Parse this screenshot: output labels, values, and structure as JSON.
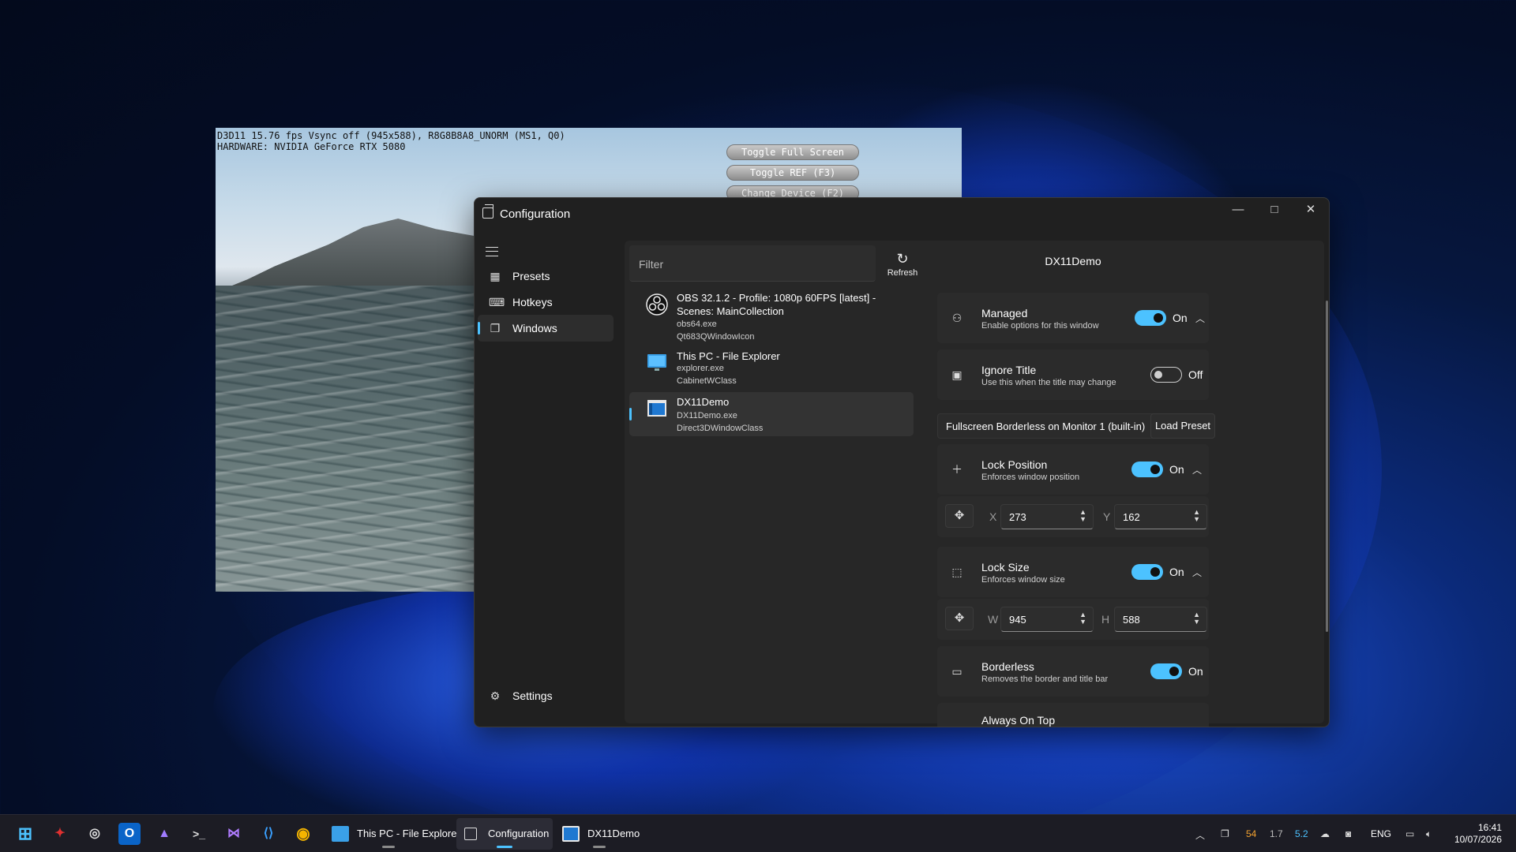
{
  "demo": {
    "hud_line1": "D3D11 15.76 fps Vsync off (945x588), R8G8B8A8_UNORM (MS1, Q0)",
    "hud_line2": "HARDWARE: NVIDIA GeForce RTX 5080",
    "buttons": [
      "Toggle Full Screen",
      "Toggle REF (F3)",
      "Change Device (F2)"
    ]
  },
  "window": {
    "title": "Configuration",
    "caption": {
      "minimize": "—",
      "maximize": "□",
      "close": "✕"
    }
  },
  "nav": {
    "items": [
      {
        "label": "Presets",
        "icon": "presets-icon"
      },
      {
        "label": "Hotkeys",
        "icon": "keyboard-icon"
      },
      {
        "label": "Windows",
        "icon": "windows-icon",
        "active": true
      }
    ],
    "settings_label": "Settings"
  },
  "filter": {
    "placeholder": "Filter"
  },
  "refresh": {
    "label": "Refresh"
  },
  "windows": [
    {
      "title": "OBS 32.1.2 - Profile: 1080p 60FPS [latest] - Scenes: MainCollection",
      "exe": "obs64.exe",
      "class": "Qt683QWindowIcon",
      "icon": "obs-icon"
    },
    {
      "title": "This PC - File Explorer",
      "exe": "explorer.exe",
      "class": "CabinetWClass",
      "icon": "monitor-icon"
    },
    {
      "title": "DX11Demo",
      "exe": "DX11Demo.exe",
      "class": "Direct3DWindowClass",
      "icon": "app-window-icon",
      "selected": true
    }
  ],
  "details": {
    "title": "DX11Demo",
    "managed": {
      "title": "Managed",
      "desc": "Enable options for this window",
      "state": "On"
    },
    "ignore_title": {
      "title": "Ignore Title",
      "desc": "Use this when the title may change",
      "state": "Off"
    },
    "preset": {
      "value": "Fullscreen Borderless on Monitor 1 (built-in)",
      "load_label": "Load Preset"
    },
    "lock_position": {
      "title": "Lock Position",
      "desc": "Enforces window position",
      "state": "On",
      "x_label": "X",
      "x": "273",
      "y_label": "Y",
      "y": "162"
    },
    "lock_size": {
      "title": "Lock Size",
      "desc": "Enforces window size",
      "state": "On",
      "w_label": "W",
      "w": "945",
      "h_label": "H",
      "h": "588"
    },
    "borderless": {
      "title": "Borderless",
      "desc": "Removes the border and title bar",
      "state": "On"
    },
    "always_on_top": {
      "title": "Always On Top"
    }
  },
  "taskbar": {
    "windows": [
      {
        "label": "This PC - File Explorer"
      },
      {
        "label": "Configuration",
        "active": true
      },
      {
        "label": "DX11Demo"
      }
    ],
    "tray": {
      "gpu_temp": "54",
      "val1": "1.7",
      "val2": "5.2",
      "lang": "ENG"
    },
    "time": "16:41",
    "date": "10/07/2026"
  },
  "colors": {
    "accent": "#4cc2ff",
    "window_bg": "#202020",
    "card_bg": "#2b2b2b"
  }
}
